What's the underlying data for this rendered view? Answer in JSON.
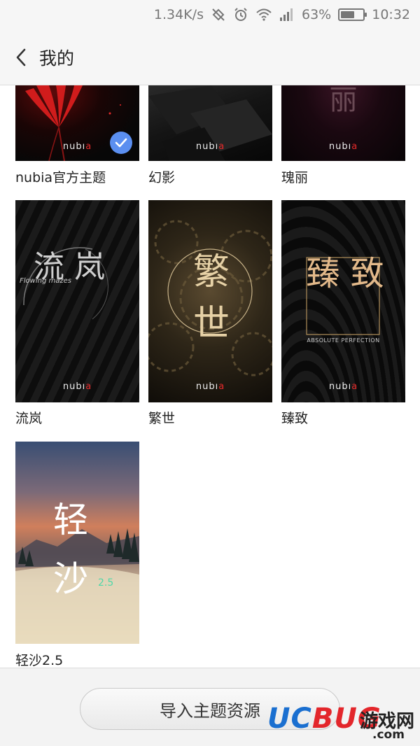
{
  "status_bar": {
    "speed": "1.34K/s",
    "battery": "63%",
    "battery_level": 0.63,
    "time": "10:32",
    "icons": [
      "nfc-icon",
      "alarm-icon",
      "wifi-icon",
      "signal-icon",
      "battery-icon"
    ]
  },
  "header": {
    "title": "我的",
    "back_icon": "chevron-left-icon"
  },
  "themes": [
    {
      "name": "nubia官方主题",
      "selected": true,
      "logo": "nubıa",
      "art_text": ""
    },
    {
      "name": "幻影",
      "selected": false,
      "logo": "nubıa",
      "art_text": ""
    },
    {
      "name": "瑰丽",
      "selected": false,
      "logo": "nubıa",
      "art_text": "丽"
    },
    {
      "name": "流岚",
      "selected": false,
      "logo": "nubıa",
      "art_text": "流 岚",
      "art_sub": "Flowing mazes"
    },
    {
      "name": "繁世",
      "selected": false,
      "logo": "nubıa",
      "art_text": "繁 世"
    },
    {
      "name": "臻致",
      "selected": false,
      "logo": "nubıa",
      "art_text": "臻 致",
      "art_sub": "ABSOLUTE PERFECTION"
    },
    {
      "name": "轻沙2.5",
      "selected": false,
      "logo": "",
      "art_text": "轻 沙",
      "art_sub": "2.5"
    }
  ],
  "bottom": {
    "import_button": "导入主题资源"
  },
  "watermark": {
    "brand_u": "UC",
    "brand_b": "BUG",
    "cn": "游戏网",
    "com": ".com"
  },
  "colors": {
    "selected_check": "#5b8ff0",
    "nubia_red": "#e52a2a",
    "watermark_blue": "#1a6fd0",
    "watermark_red": "#e3262b"
  }
}
